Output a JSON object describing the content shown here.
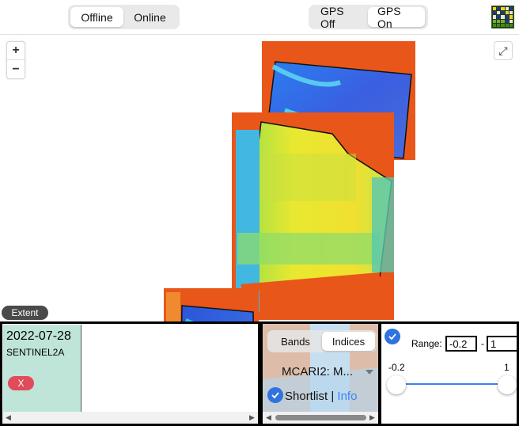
{
  "topbar": {
    "connection": {
      "options": [
        "Offline",
        "Online"
      ],
      "active": "Offline"
    },
    "gps": {
      "options": [
        "GPS Off",
        "GPS On"
      ],
      "active": "GPS On"
    },
    "logo": {
      "icon": "grid-logo-icon"
    }
  },
  "map": {
    "zoom_in": "+",
    "zoom_out": "−",
    "fullscreen": "⤢",
    "extent_button": "Extent"
  },
  "date_panel": {
    "date": "2022-07-28",
    "satellite": "SENTINEL2A",
    "remove_label": "X",
    "scroll_left": "◀",
    "scroll_right": "▶"
  },
  "bands_panel": {
    "tabs": [
      "Bands",
      "Indices"
    ],
    "active_tab": "Indices",
    "selected_index": "MCARI2: M...",
    "shortlist_label": "Shortlist | ",
    "info_label": "Info",
    "shortlist_checked": true,
    "scroll_left": "◀",
    "scroll_right": "▶"
  },
  "range_panel": {
    "enabled": true,
    "range_label": "Range:",
    "min_value": "-0.2",
    "max_value": "1",
    "slider_min_label": "-0.2",
    "slider_max_label": "1",
    "dash": "-"
  },
  "colors": {
    "accent": "#2f73e0",
    "danger": "#e14b5a",
    "date_card": "#bfe5d9"
  }
}
